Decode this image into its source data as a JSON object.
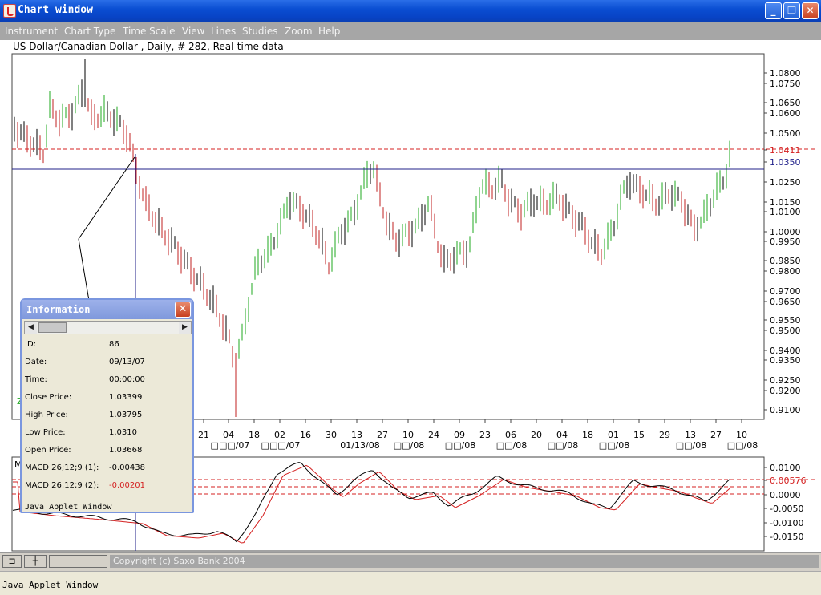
{
  "window": {
    "title": "Chart window",
    "minimize_glyph": "_",
    "maximize_glyph": "❐",
    "close_glyph": "✕",
    "icon": "java-cup-icon"
  },
  "menu": [
    "Instrument",
    "Chart Type",
    "Time Scale",
    "View",
    "Lines",
    "Studies",
    "Zoom",
    "Help"
  ],
  "chart_header": "US Dollar/Canadian Dollar , Daily, # 282, Real-time data",
  "price_axis": [
    "1.0800",
    "1.0750",
    "1.0650",
    "1.0600",
    "1.0500",
    "1.0411",
    "1.0350",
    "1.0250",
    "1.0150",
    "1.0100",
    "1.0000",
    "0.9950",
    "0.9850",
    "0.9800",
    "0.9700",
    "0.9650",
    "0.9550",
    "0.9500",
    "0.9400",
    "0.9350",
    "0.9250",
    "0.9200",
    "0.9100"
  ],
  "price_marker": {
    "label": "1.0411",
    "color": "#d42020"
  },
  "horizontal_line": {
    "label": "1.0350",
    "color": "#20208a"
  },
  "date_ticks": [
    "21",
    "04",
    "18",
    "02",
    "16",
    "30",
    "13",
    "27",
    "10",
    "24",
    "09",
    "23",
    "06",
    "20",
    "04",
    "18",
    "01",
    "15",
    "29",
    "13",
    "27",
    "10"
  ],
  "month_labels": [
    "□□□/07",
    "□□□/07",
    "01/13/08",
    "□□/08",
    "□□/08",
    "□□/08",
    "□□/08",
    "□□/08",
    "□□/08",
    "□□/08"
  ],
  "macd_axis": [
    "0.0100",
    "0.00576",
    "0.0000",
    "-0.0050",
    "-0.0100",
    "-0.0150"
  ],
  "macd_marker_color": "#d42020",
  "macd_label_partial": "M",
  "left_stub_label": "Z",
  "status": {
    "copyright": "Copyright (c) Saxo Bank 2004",
    "btn_pin": "⊐",
    "btn_cross": "┼"
  },
  "applet_footer": "Java Applet Window",
  "info": {
    "title": "Information",
    "close_glyph": "✕",
    "scroll_left": "◀",
    "scroll_right": "▶",
    "rows": [
      {
        "label": "ID:",
        "value": "86"
      },
      {
        "label": "Date:",
        "value": "09/13/07"
      },
      {
        "label": "Time:",
        "value": "00:00:00"
      },
      {
        "label": "Close Price:",
        "value": "1.03399"
      },
      {
        "label": "High Price:",
        "value": "1.03795"
      },
      {
        "label": "Low Price:",
        "value": "1.0310"
      },
      {
        "label": "Open Price:",
        "value": "1.03668"
      },
      {
        "label": "MACD 26;12;9 (1):",
        "value": "-0.00438"
      },
      {
        "label": "MACD 26;12;9 (2):",
        "value": "-0.00201",
        "color": "#d42020"
      }
    ],
    "footer": "Java Applet Window"
  },
  "colors": {
    "up_bar": "#1fa81f",
    "down_bar": "#c02020",
    "neutral_bar": "#000000",
    "macd_line": "#000000",
    "signal_line": "#d42020"
  }
}
